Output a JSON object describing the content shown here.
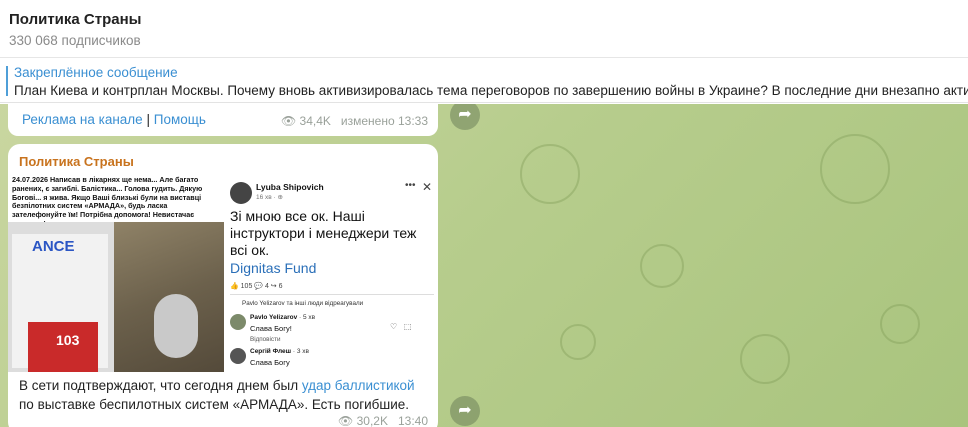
{
  "channel": {
    "title": "Политика Страны",
    "subscribers": "330 068 подписчиков"
  },
  "pinned": {
    "title": "Закреплённое сообщение",
    "text": "План Киева и контрплан Москвы. Почему вновь активизировалась тема переговоров по завершению войны в Украине?  В последние дни внезапно акти"
  },
  "msg1": {
    "link_ad": "Реклама на канале",
    "separator": "|",
    "link_help": "Помощь",
    "views": "34,4K",
    "edited": "изменено 13:33"
  },
  "msg2": {
    "author": "Политика Страны",
    "image": {
      "left_caption": "24.07.2026 Написав в лікарнях ще нема... Але багато ранених, є загиблі. Балістика... Голова гудить. Дякую Богові... я жива. Якщо Ваші близькі були на виставці безпілотних систем «АРМАДА», будь ласка зателефонуйте їм! Потрібна допомога! Невистачає швидких!",
      "ambulance_text": "ANCE",
      "ambulance_number": "103",
      "fb_name": "Lyuba Shipovich",
      "fb_time": "16 хв · ⊕",
      "fb_text": "Зі мною все ок. Наші інструктори і менеджери теж всі ок.",
      "fb_fund": "Dignitas Fund",
      "fb_reactions": "👍 105   💬 4   ↪ 6",
      "fb_likers": "Pavlo Yelizarov та інші люди відреагували",
      "c1_name": "Pavlo Yelizarov",
      "c1_time": "· 5 хв",
      "c1_text": "Слава Богу!",
      "c1_reply": "Відповісти",
      "c2_name": "Сергій Флеш",
      "c2_time": "· 3 хв",
      "c2_text": "Слава Богу"
    },
    "text_before": "В сети подтверждают, что сегодня днем был ",
    "text_link": "удар баллистикой",
    "text_after": " по выставке беспилотных систем «АРМАДА». Есть погибшие.",
    "views": "30,2K",
    "time": "13:40"
  },
  "icons": {
    "share": "share-arrow-icon",
    "views": "eye-icon"
  },
  "colors": {
    "link": "#3a8fd2",
    "author": "#c8731e",
    "chat_bg": "#b7cd8d"
  }
}
